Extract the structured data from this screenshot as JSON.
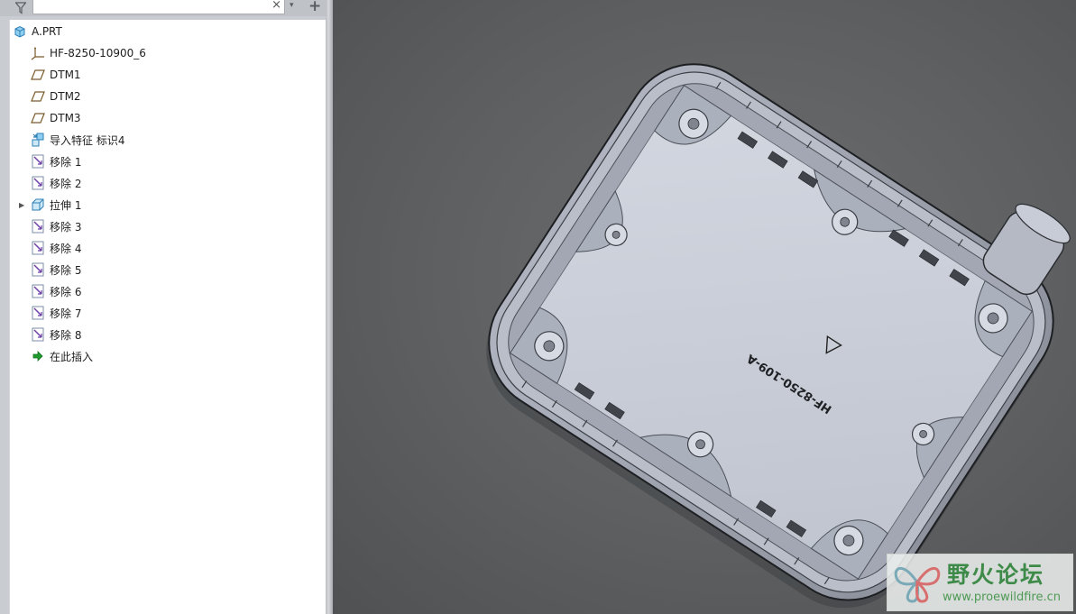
{
  "toolbar": {
    "search_value": "",
    "filter_icon": "filter-icon",
    "clear_glyph": "×",
    "dropdown_glyph": "▾",
    "add_glyph": "+"
  },
  "tree": {
    "items": [
      {
        "label": "A.PRT",
        "icon": "part-icon"
      },
      {
        "label": "HF-8250-10900_6",
        "icon": "coordinate-system-icon"
      },
      {
        "label": "DTM1",
        "icon": "datum-plane-icon"
      },
      {
        "label": "DTM2",
        "icon": "datum-plane-icon"
      },
      {
        "label": "DTM3",
        "icon": "datum-plane-icon"
      },
      {
        "label": "导入特征 标识4",
        "icon": "import-feature-icon"
      },
      {
        "label": "移除 1",
        "icon": "remove-feature-icon"
      },
      {
        "label": "移除 2",
        "icon": "remove-feature-icon"
      },
      {
        "label": "拉伸 1",
        "icon": "extrude-icon",
        "expandable": true
      },
      {
        "label": "移除 3",
        "icon": "remove-feature-icon"
      },
      {
        "label": "移除 4",
        "icon": "remove-feature-icon"
      },
      {
        "label": "移除 5",
        "icon": "remove-feature-icon"
      },
      {
        "label": "移除 6",
        "icon": "remove-feature-icon"
      },
      {
        "label": "移除 7",
        "icon": "remove-feature-icon"
      },
      {
        "label": "移除 8",
        "icon": "remove-feature-icon"
      },
      {
        "label": "在此插入",
        "icon": "insert-here-icon"
      }
    ]
  },
  "viewport": {
    "part_marking": "HF-8250-109-A",
    "model_color": "#c8ccd6",
    "background_color": "#5e6062"
  },
  "watermark": {
    "title": "野火论坛",
    "url": "www.proewildfire.cn"
  }
}
